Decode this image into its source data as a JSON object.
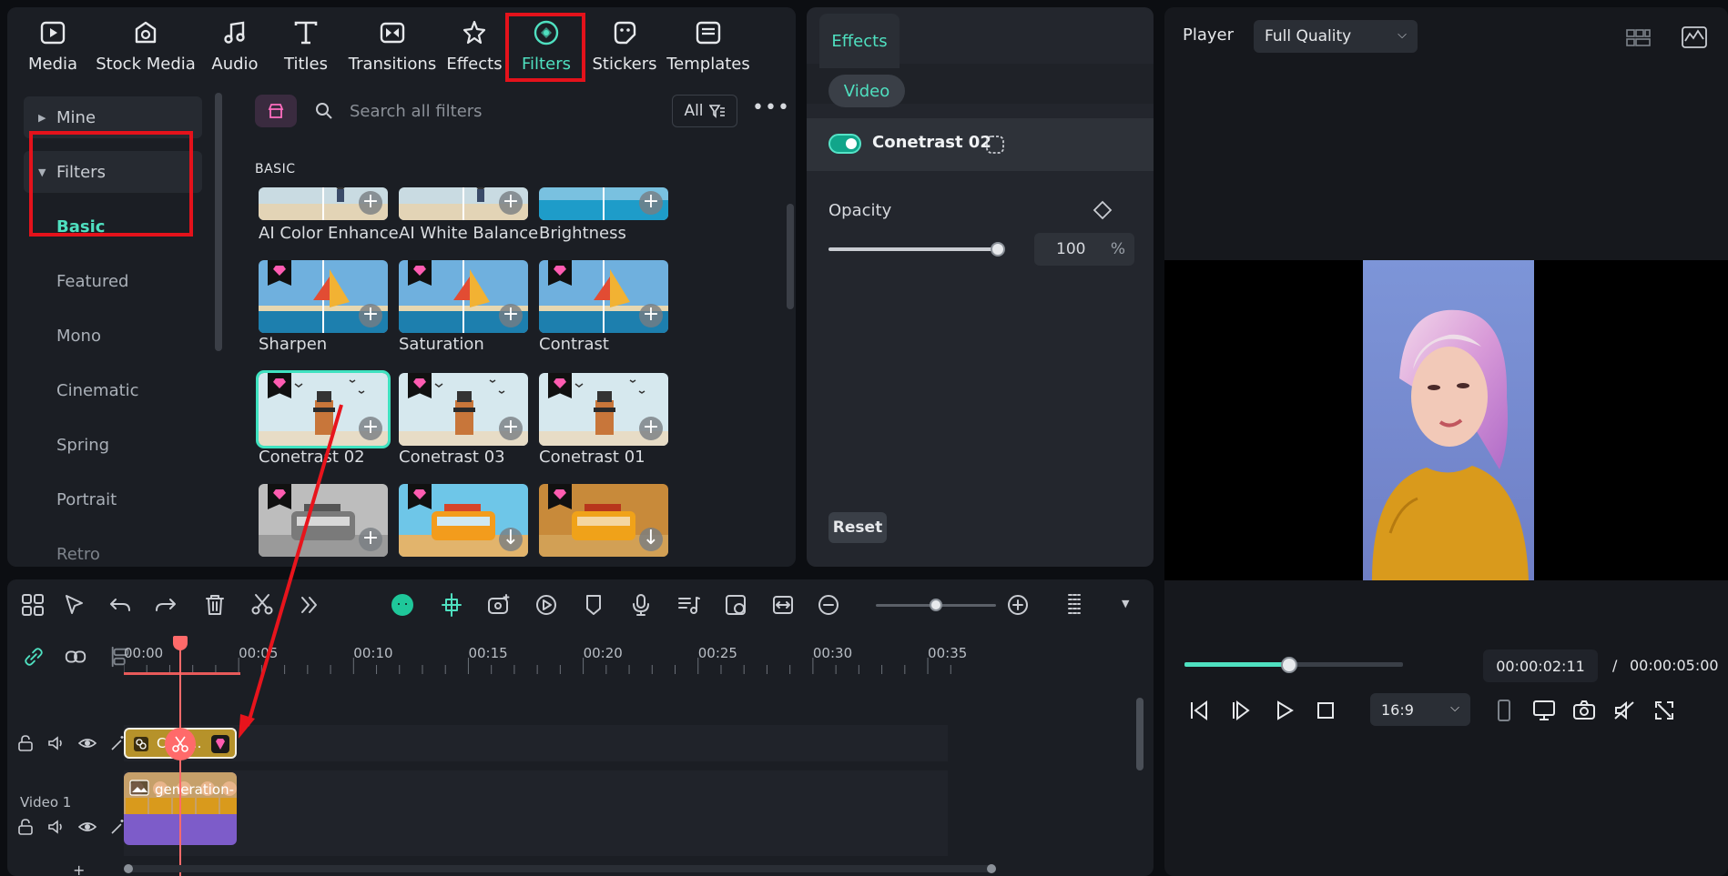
{
  "toptabs": [
    {
      "label": "Media",
      "icon": "media-icon"
    },
    {
      "label": "Stock Media",
      "icon": "stock-media-icon"
    },
    {
      "label": "Audio",
      "icon": "audio-icon"
    },
    {
      "label": "Titles",
      "icon": "titles-icon"
    },
    {
      "label": "Transitions",
      "icon": "transitions-icon"
    },
    {
      "label": "Effects",
      "icon": "effects-icon"
    },
    {
      "label": "Filters",
      "icon": "filters-icon",
      "active": true
    },
    {
      "label": "Stickers",
      "icon": "stickers-icon"
    },
    {
      "label": "Templates",
      "icon": "templates-icon"
    }
  ],
  "sidebar": {
    "items": [
      {
        "label": "Mine"
      },
      {
        "label": "Filters"
      },
      {
        "label": "Basic"
      },
      {
        "label": "Featured"
      },
      {
        "label": "Mono"
      },
      {
        "label": "Cinematic"
      },
      {
        "label": "Spring"
      },
      {
        "label": "Portrait"
      },
      {
        "label": "Retro"
      }
    ]
  },
  "search": {
    "placeholder": "Search all filters",
    "filter_label": "All"
  },
  "section_label": "BASIC",
  "filters": [
    {
      "label": "AI Color Enhance",
      "scene": "beach"
    },
    {
      "label": "AI White Balance",
      "scene": "beach"
    },
    {
      "label": "Brightness",
      "scene": "sea"
    },
    {
      "label": "Sharpen",
      "scene": "sail",
      "premium": true
    },
    {
      "label": "Saturation",
      "scene": "sail",
      "premium": true
    },
    {
      "label": "Contrast",
      "scene": "sail",
      "premium": true
    },
    {
      "label": "Conetrast 02",
      "scene": "tower",
      "premium": true,
      "selected": true
    },
    {
      "label": "Conetrast 03",
      "scene": "tower",
      "premium": true
    },
    {
      "label": "Conetrast 01",
      "scene": "tower",
      "premium": true
    },
    {
      "label": "",
      "scene": "bus-mono",
      "premium": true
    },
    {
      "label": "",
      "scene": "bus",
      "premium": true
    },
    {
      "label": "",
      "scene": "bus-warm",
      "premium": true
    }
  ],
  "effects_panel": {
    "tab": "Effects",
    "video_pill": "Video",
    "effect_name": "Conetrast 02",
    "opacity_label": "Opacity",
    "opacity_value": "100",
    "opacity_unit": "%",
    "opacity_level": 1.0,
    "reset": "Reset"
  },
  "player": {
    "title": "Player",
    "quality": "Full Quality",
    "current_time": "00:00:02:11",
    "separator": "/",
    "total_time": "00:00:05:00",
    "ratio": "16:9",
    "progress": 0.48
  },
  "timeline": {
    "ruler": [
      "00:00",
      "00:05",
      "00:10",
      "00:15",
      "00:20",
      "00:25",
      "00:30",
      "00:35"
    ],
    "filter_clip": "Cont...",
    "video_clip": "generation-",
    "track_name": "Video 1",
    "zoom_level": 0.5,
    "add": "+"
  },
  "colors": {
    "accent": "#4fe0c0",
    "highlight": "#e4121b",
    "clip_filter": "#b6922a",
    "clip_video": "#7d5cc9"
  }
}
